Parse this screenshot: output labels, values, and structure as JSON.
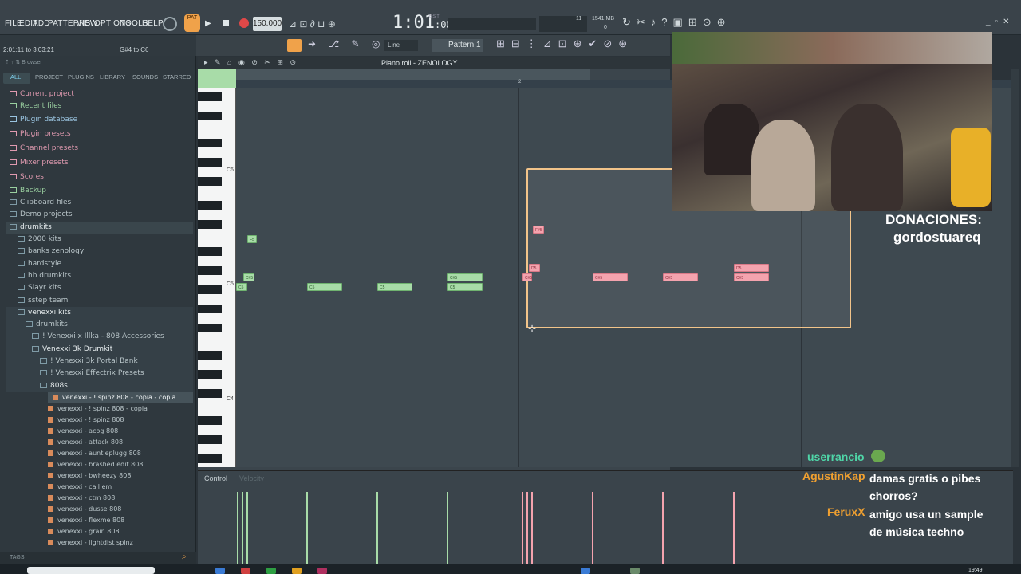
{
  "menu": [
    "FILE",
    "EDIT",
    "ADD",
    "PATTERNS",
    "VIEW",
    "OPTIONS",
    "TOOLS",
    "HELP"
  ],
  "transport": {
    "mode": "PAT",
    "tempo": "150.000",
    "time": "1:01",
    "time_sub": ":00",
    "time_label": "B:S:T",
    "cpu_num": "11",
    "memory": "1541 MB",
    "voices": "0"
  },
  "hint": {
    "range": "2:01:11 to 3:03:21",
    "note": "G#4 to C6"
  },
  "toolbar": {
    "snap": "Line",
    "pattern": "Pattern 1",
    "pianoroll_title": "Piano roll - ZENOLOGY"
  },
  "browser": {
    "title": "Browser",
    "tabs": [
      "ALL",
      "PROJECT",
      "PLUGINS",
      "LIBRARY",
      "SOUNDS",
      "STARRED"
    ],
    "items": [
      "Current project",
      "Recent files",
      "Plugin database",
      "Plugin presets",
      "Channel presets",
      "Mixer presets",
      "Scores",
      "Backup",
      "Clipboard files",
      "Demo projects",
      "drumkits",
      "2000 kits",
      "banks zenology",
      "hardstyle",
      "hb drumkits",
      "Slayr kits",
      "sstep team",
      "venexxi kits",
      "drumkits",
      "! Venexxi x Illka - 808 Accessories",
      "Venexxi 3k Drumkit",
      "! Venexxi 3k Portal Bank",
      "! Venexxi Effectrix Presets",
      "808s"
    ],
    "files": [
      "venexxi - ! spinz 808 - copia - copia",
      "venexxi - ! spinz 808 - copia",
      "venexxi - ! spinz 808",
      "venexxi - acog 808",
      "venexxi - attack 808",
      "venexxi - auntieplugg 808",
      "venexxi - brashed edit 808",
      "venexxi - bwheezy 808",
      "venexxi - call em",
      "venexxi - ctm 808",
      "venexxi - dusse 808",
      "venexxi - flexme 808",
      "venexxi - grain 808",
      "venexxi - lightdist spinz"
    ],
    "tags": "TAGS"
  },
  "keys": {
    "c6": "C6",
    "c5": "C5",
    "c4": "C4"
  },
  "bar_marker": "2",
  "notes_green": [
    "F5",
    "C#5",
    "C5",
    "C5",
    "C5",
    "C#5",
    "C5"
  ],
  "notes_pink": [
    "F#5",
    "D5",
    "C#5",
    "C#5",
    "C#5",
    "D5",
    "C#5"
  ],
  "control": {
    "label": "Control",
    "sub": "Velocity"
  },
  "overlay": {
    "donations_title": "DONACIONES:",
    "donations_user": "gordostuareq"
  },
  "chat": [
    {
      "user": "userrancio",
      "msg": "",
      "color": "#4fd6a8"
    },
    {
      "user": "AgustinKap",
      "msg": "damas gratis o pibes chorros?",
      "color": "#f0a030"
    },
    {
      "user": "FeruxX",
      "msg": "amigo usa un sample de música techno",
      "color": "#f0a030"
    }
  ],
  "clock": "19:49"
}
